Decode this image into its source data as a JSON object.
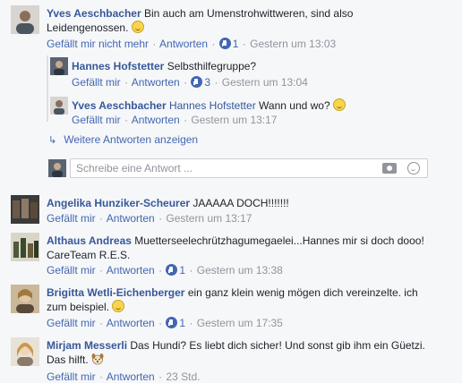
{
  "like_label": "Gefällt mir",
  "unlike_label": "Gefällt mir nicht mehr",
  "reply_label": "Antworten",
  "colors": {
    "link": "#4267b2",
    "name": "#365899",
    "meta": "#90949c",
    "bg": "#f6f7f9"
  },
  "comments": [
    {
      "author": "Yves Aeschbacher",
      "text_line1": "Bin auch am Umenstrohwittweren, sind also",
      "text_line2": "Leidengenossen.",
      "emoji": "grinning-face-emoji",
      "like_action": "Gefällt mir nicht mehr",
      "likes": "1",
      "time": "Gestern um 13:03",
      "replies": [
        {
          "author": "Hannes Hofstetter",
          "text": "Selbsthilfegruppe?",
          "like_action": "Gefällt mir",
          "likes": "3",
          "time": "Gestern um 13:04"
        },
        {
          "author": "Yves Aeschbacher",
          "mention": "Hannes Hofstetter",
          "text": "Wann und wo?",
          "emoji": "grinning-squint-emoji",
          "like_action": "Gefällt mir",
          "time": "Gestern um 13:17"
        }
      ],
      "more_replies": "Weitere Antworten anzeigen",
      "reply_placeholder": "Schreibe eine Antwort ..."
    },
    {
      "author": "Angelika Hunziker-Scheurer",
      "text": "JAAAAA DOCH!!!!!!!",
      "like_action": "Gefällt mir",
      "time": "Gestern um 13:17"
    },
    {
      "author": "Althaus Andreas",
      "text_line1": "Muetterseelechrützhagumegaelei...Hannes mir si doch dooo!",
      "text_line2": "CareTeam R.E.S.",
      "like_action": "Gefällt mir",
      "likes": "1",
      "time": "Gestern um 13:38"
    },
    {
      "author": "Brigitta Wetli-Eichenberger",
      "text_line1": "ein ganz klein wenig mögen dich vereinzelte. ich",
      "text_line2": "zum beispiel.",
      "emoji": "slightly-smiling-emoji",
      "like_action": "Gefällt mir",
      "likes": "1",
      "time": "Gestern um 17:35"
    },
    {
      "author": "Mirjam Messerli",
      "text_line1": "Das Hundi? Es liebt dich sicher! Und sonst gib ihm ein Güetzi.",
      "text_line2": "Das hilft.",
      "emoji": "dog-face-emoji",
      "like_action": "Gefällt mir",
      "time": "23 Std."
    }
  ]
}
